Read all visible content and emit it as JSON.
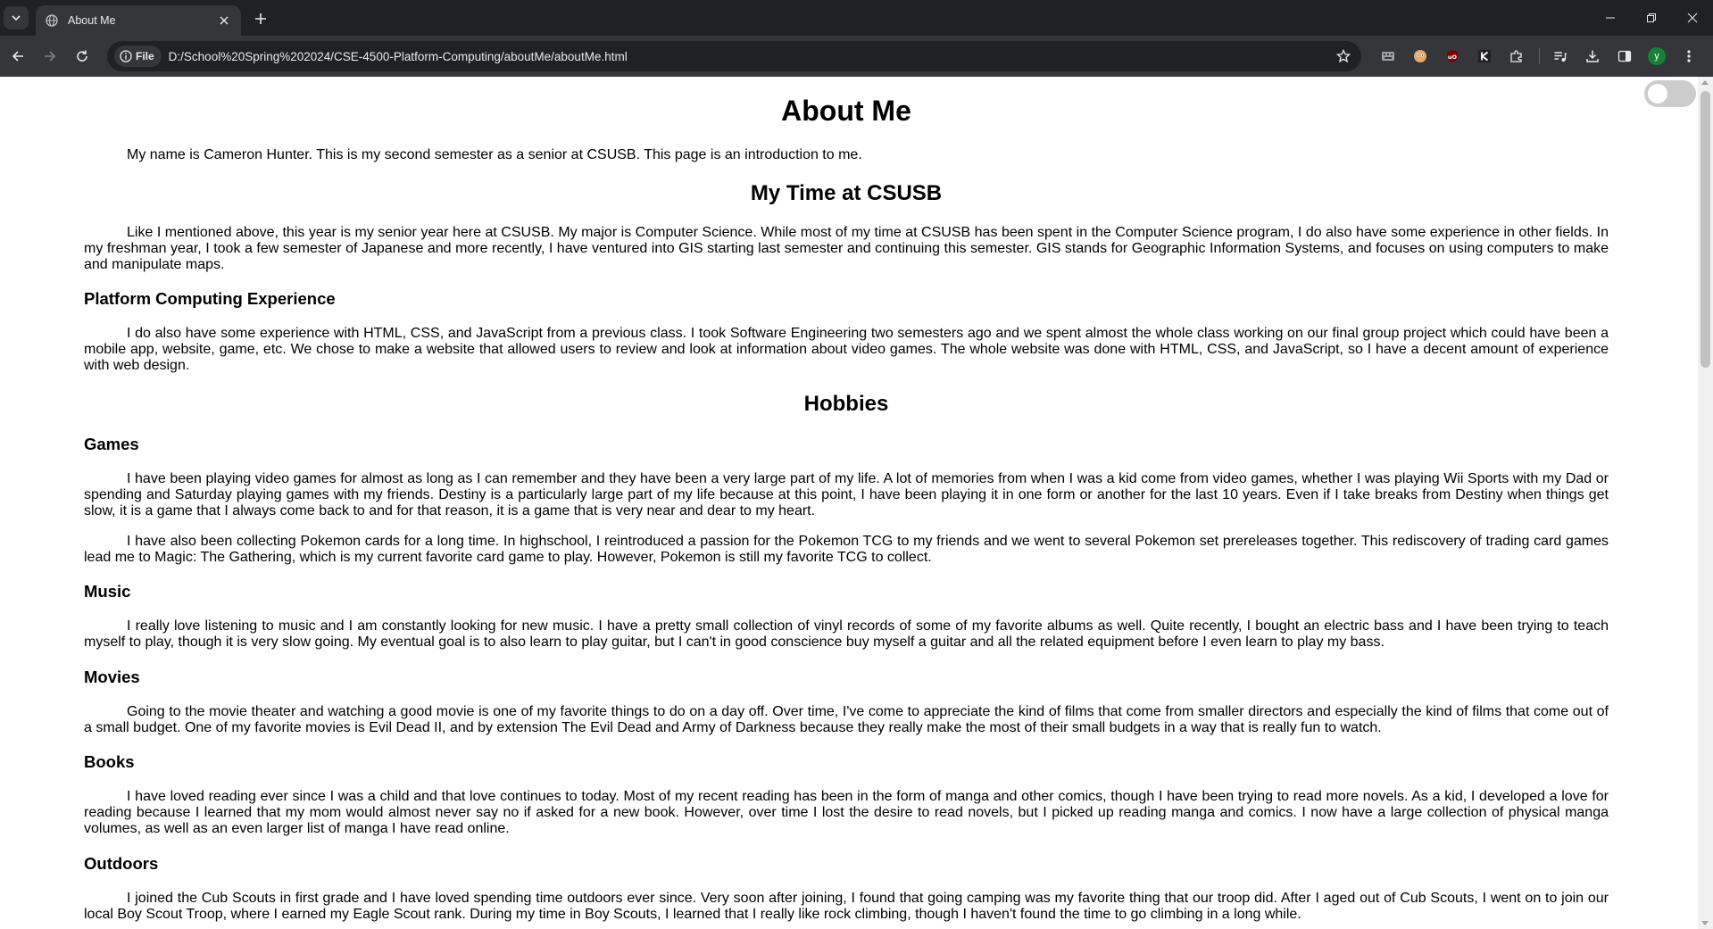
{
  "browser": {
    "tab": {
      "title": "About Me"
    },
    "address": {
      "chip_label": "File",
      "url": "D:/School%20Spring%202024/CSE-4500-Platform-Computing/aboutMe/aboutMe.html"
    },
    "profile_initial": "y"
  },
  "page": {
    "title": "About Me",
    "intro": "My name is Cameron Hunter. This is my second semester as a senior at CSUSB. This page is an introduction to me.",
    "time_heading": "My Time at CSUSB",
    "time_text": "Like I mentioned above, this year is my senior year here at CSUSB. My major is Computer Science. While most of my time at CSUSB has been spent in the Computer Science program, I do also have some experience in other fields. In my freshman year, I took a few semester of Japanese and more recently, I have ventured into GIS starting last semester and continuing this semester. GIS stands for Geographic Information Systems, and focuses on using computers to make and manipulate maps.",
    "platform_heading": "Platform Computing Experience",
    "platform_text": "I do also have some experience with HTML, CSS, and JavaScript from a previous class. I took Software Engineering two semesters ago and we spent almost the whole class working on our final group project which could have been a mobile app, website, game, etc. We chose to make a website that allowed users to review and look at information about video games. The whole website was done with HTML, CSS, and JavaScript, so I have a decent amount of experience with web design.",
    "hobbies_heading": "Hobbies",
    "games_heading": "Games",
    "games_text_1": "I have been playing video games for almost as long as I can remember and they have been a very large part of my life. A lot of memories from when I was a kid come from video games, whether I was playing Wii Sports with my Dad or spending and Saturday playing games with my friends. Destiny is a particularly large part of my life because at this point, I have been playing it in one form or another for the last 10 years. Even if I take breaks from Destiny when things get slow, it is a game that I always come back to and for that reason, it is a game that is very near and dear to my heart.",
    "games_text_2": "I have also been collecting Pokemon cards for a long time. In highschool, I reintroduced a passion for the Pokemon TCG to my friends and we went to several Pokemon set prereleases together. This rediscovery of trading card games lead me to Magic: The Gathering, which is my current favorite card game to play. However, Pokemon is still my favorite TCG to collect.",
    "music_heading": "Music",
    "music_text": "I really love listening to music and I am constantly looking for new music. I have a pretty small collection of vinyl records of some of my favorite albums as well. Quite recently, I bought an electric bass and I have been trying to teach myself to play, though it is very slow going. My eventual goal is to also learn to play guitar, but I can't in good conscience buy myself a guitar and all the related equipment before I even learn to play my bass.",
    "movies_heading": "Movies",
    "movies_text": "Going to the movie theater and watching a good movie is one of my favorite things to do on a day off. Over time, I've come to appreciate the kind of films that come from smaller directors and especially the kind of films that come out of a small budget. One of my favorite movies is Evil Dead II, and by extension The Evil Dead and Army of Darkness because they really make the most of their small budgets in a way that is really fun to watch.",
    "books_heading": "Books",
    "books_text": "I have loved reading ever since I was a child and that love continues to today. Most of my recent reading has been in the form of manga and other comics, though I have been trying to read more novels. As a kid, I developed a love for reading because I learned that my mom would almost never say no if asked for a new book. However, over time I lost the desire to read novels, but I picked up reading manga and comics. I now have a large collection of physical manga volumes, as well as an even larger list of manga I have read online.",
    "outdoors_heading": "Outdoors",
    "outdoors_text": "I joined the Cub Scouts in first grade and I have loved spending time outdoors ever since. Very soon after joining, I found that going camping was my favorite thing that our troop did. After I aged out of Cub Scouts, I went on to join our local Boy Scout Troop, where I earned my Eagle Scout rank. During my time in Boy Scouts, I learned that I really like rock climbing, though I haven't found the time to go climbing in a long while."
  },
  "colors": {
    "chrome_dark": "#202124",
    "chrome_toolbar": "#35363a",
    "page_bg": "#ffffff",
    "text": "#000000"
  },
  "icons": [
    "tab-search-icon",
    "globe-icon",
    "close-icon",
    "plus-icon",
    "back-icon",
    "forward-icon",
    "reload-icon",
    "info-icon",
    "star-icon",
    "extension-icon",
    "download-icon",
    "sidepanel-icon",
    "menu-icon",
    "minimize-icon",
    "restore-icon"
  ]
}
